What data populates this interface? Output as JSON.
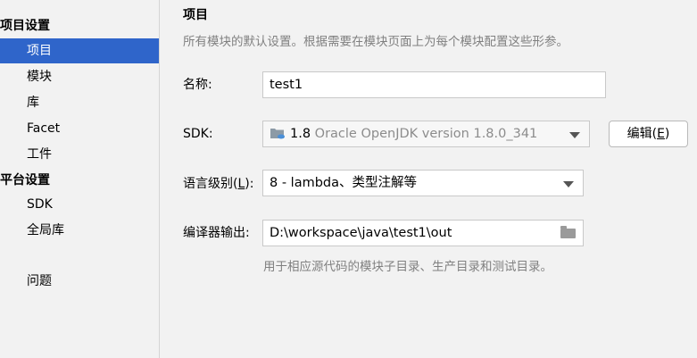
{
  "sidebar": {
    "groups": [
      {
        "label": "项目设置",
        "items": [
          "项目",
          "模块",
          "库",
          "Facet",
          "工件"
        ]
      },
      {
        "label": "平台设置",
        "items": [
          "SDK",
          "全局库"
        ]
      }
    ],
    "extra_items": [
      "问题"
    ],
    "selected": "项目"
  },
  "main": {
    "title": "项目",
    "description": "所有模块的默认设置。根据需要在模块页面上为每个模块配置这些形参。",
    "name": {
      "label": "名称:",
      "value": "test1"
    },
    "sdk": {
      "label": "SDK:",
      "version_main": "1.8",
      "version_detail": "Oracle OpenJDK version 1.8.0_341",
      "edit_label_prefix": "编辑(",
      "edit_mnemonic": "E",
      "edit_label_suffix": ")"
    },
    "language_level": {
      "label_prefix": "语言级别(",
      "label_mnemonic": "L",
      "label_suffix": "):",
      "value": "8 - lambda、类型注解等"
    },
    "compiler_output": {
      "label": "编译器输出:",
      "value": "D:\\workspace\\java\\test1\\out",
      "hint": "用于相应源代码的模块子目录、生产目录和测试目录。"
    }
  },
  "colors": {
    "selection": "#2f65ca",
    "background": "#f2f2f2",
    "muted_text": "#808080"
  },
  "icons": [
    "sdk-folder-icon",
    "dropdown-arrow-icon",
    "folder-browse-icon"
  ]
}
